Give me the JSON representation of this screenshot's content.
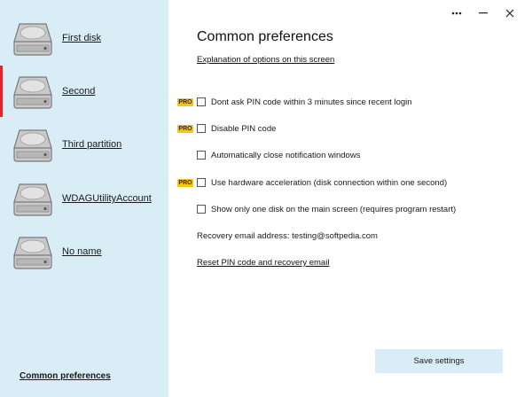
{
  "sidebar": {
    "disks": [
      {
        "label": "First disk"
      },
      {
        "label": "Second"
      },
      {
        "label": "Third partition"
      },
      {
        "label": "WDAGUtilityAccount"
      },
      {
        "label": "No name"
      }
    ],
    "active_index": 1,
    "common_link": "Common preferences"
  },
  "window": {
    "more_icon": "more-horizontal-icon",
    "minimize_icon": "minimize-icon",
    "close_icon": "close-icon"
  },
  "main": {
    "title": "Common preferences",
    "explain_link": "Explanation of options on this screen",
    "pro_label": "PRO",
    "options": [
      {
        "label": "Dont ask PIN code within 3 minutes since recent login",
        "pro": true,
        "checked": false
      },
      {
        "label": "Disable PIN code",
        "pro": true,
        "checked": false
      },
      {
        "label": "Automatically close notification windows",
        "pro": false,
        "checked": false
      },
      {
        "label": "Use hardware acceleration (disk connection within one second)",
        "pro": true,
        "checked": false
      },
      {
        "label": "Show only one disk on the main screen (requires program restart)",
        "pro": false,
        "checked": false
      }
    ],
    "recovery_text": "Recovery email address: testing@softpedia.com",
    "reset_link": "Reset PIN code and recovery email",
    "save_label": "Save settings"
  },
  "colors": {
    "sidebar_bg": "#d8edf6",
    "active_marker": "#e8202a",
    "pro_badge": "#f5c518"
  }
}
